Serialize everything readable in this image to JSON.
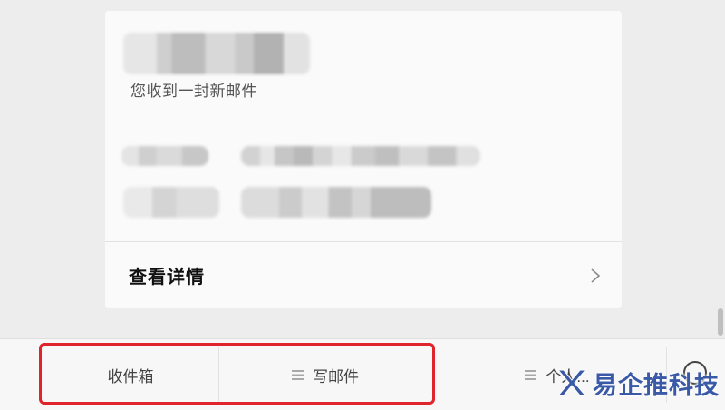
{
  "message_card": {
    "notice": "您收到一封新邮件",
    "details_label": "查看详情",
    "chevron_icon": "chevron-right-icon"
  },
  "menu_bar": {
    "items": [
      {
        "label": "收件箱",
        "icon": ""
      },
      {
        "label": "写邮件",
        "icon": "menu-lines-icon"
      },
      {
        "label": "个人...",
        "icon": "menu-lines-icon"
      }
    ],
    "right_icon": "circle-icon"
  },
  "annotation": {
    "highlight_color": "#e0242b"
  },
  "watermark": {
    "text": "易企推科技",
    "logo_icon": "x-logo-icon",
    "color": "#3a5aa8"
  }
}
